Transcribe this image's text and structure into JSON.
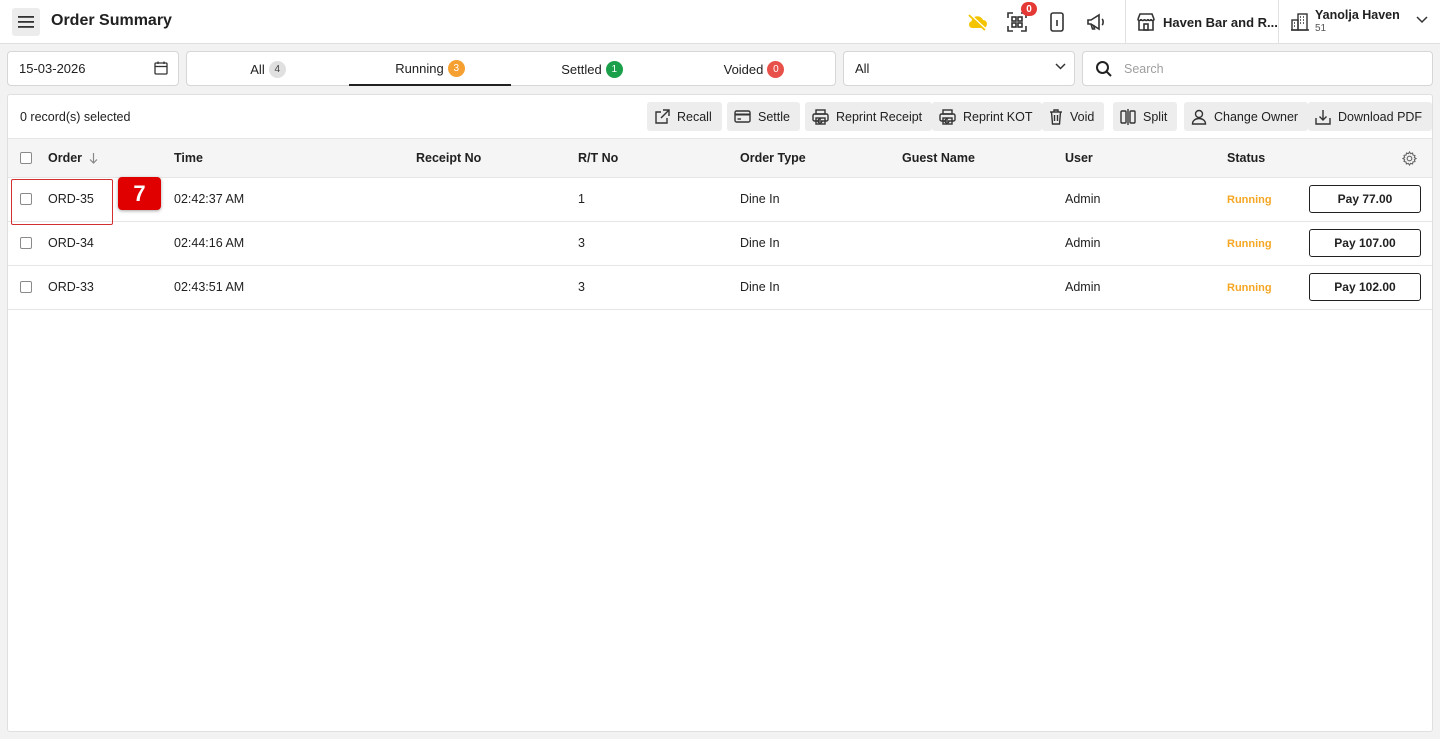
{
  "header": {
    "title": "Order Summary",
    "notification_count": "0",
    "venue_name": "Haven Bar and R...",
    "org_name": "Yanolja Haven",
    "org_sub": "51"
  },
  "filters": {
    "date": "15-03-2026",
    "tabs": [
      {
        "label": "All",
        "count": "4",
        "badge_color": "#e0e0e0",
        "badge_text_color": "#424242"
      },
      {
        "label": "Running",
        "count": "3",
        "badge_color": "#f5a031",
        "badge_text_color": "#ffffff"
      },
      {
        "label": "Settled",
        "count": "1",
        "badge_color": "#1aa04a",
        "badge_text_color": "#ffffff"
      },
      {
        "label": "Voided",
        "count": "0",
        "badge_color": "#e8514a",
        "badge_text_color": "#ffffff"
      }
    ],
    "active_tab": "Running",
    "select_value": "All",
    "search_placeholder": "Search"
  },
  "toolbar": {
    "selected_text": "0 record(s) selected",
    "actions": [
      "Recall",
      "Settle",
      "Reprint Receipt",
      "Reprint KOT",
      "Void",
      "Split",
      "Change Owner",
      "Download PDF"
    ]
  },
  "table": {
    "columns": [
      "Order",
      "Time",
      "Receipt No",
      "R/T No",
      "Order Type",
      "Guest Name",
      "User",
      "Status"
    ],
    "rows": [
      {
        "order": "ORD-35",
        "time": "02:42:37 AM",
        "receipt": "",
        "rt": "1",
        "type": "Dine In",
        "guest": "",
        "user": "Admin",
        "status": "Running",
        "pay": "Pay 77.00"
      },
      {
        "order": "ORD-34",
        "time": "02:44:16 AM",
        "receipt": "",
        "rt": "3",
        "type": "Dine In",
        "guest": "",
        "user": "Admin",
        "status": "Running",
        "pay": "Pay 107.00"
      },
      {
        "order": "ORD-33",
        "time": "02:43:51 AM",
        "receipt": "",
        "rt": "3",
        "type": "Dine In",
        "guest": "",
        "user": "Admin",
        "status": "Running",
        "pay": "Pay 102.00"
      }
    ]
  },
  "annotation": {
    "step": "7"
  },
  "colors": {
    "status_running": "#f5a623",
    "highlight": "#e00000"
  }
}
